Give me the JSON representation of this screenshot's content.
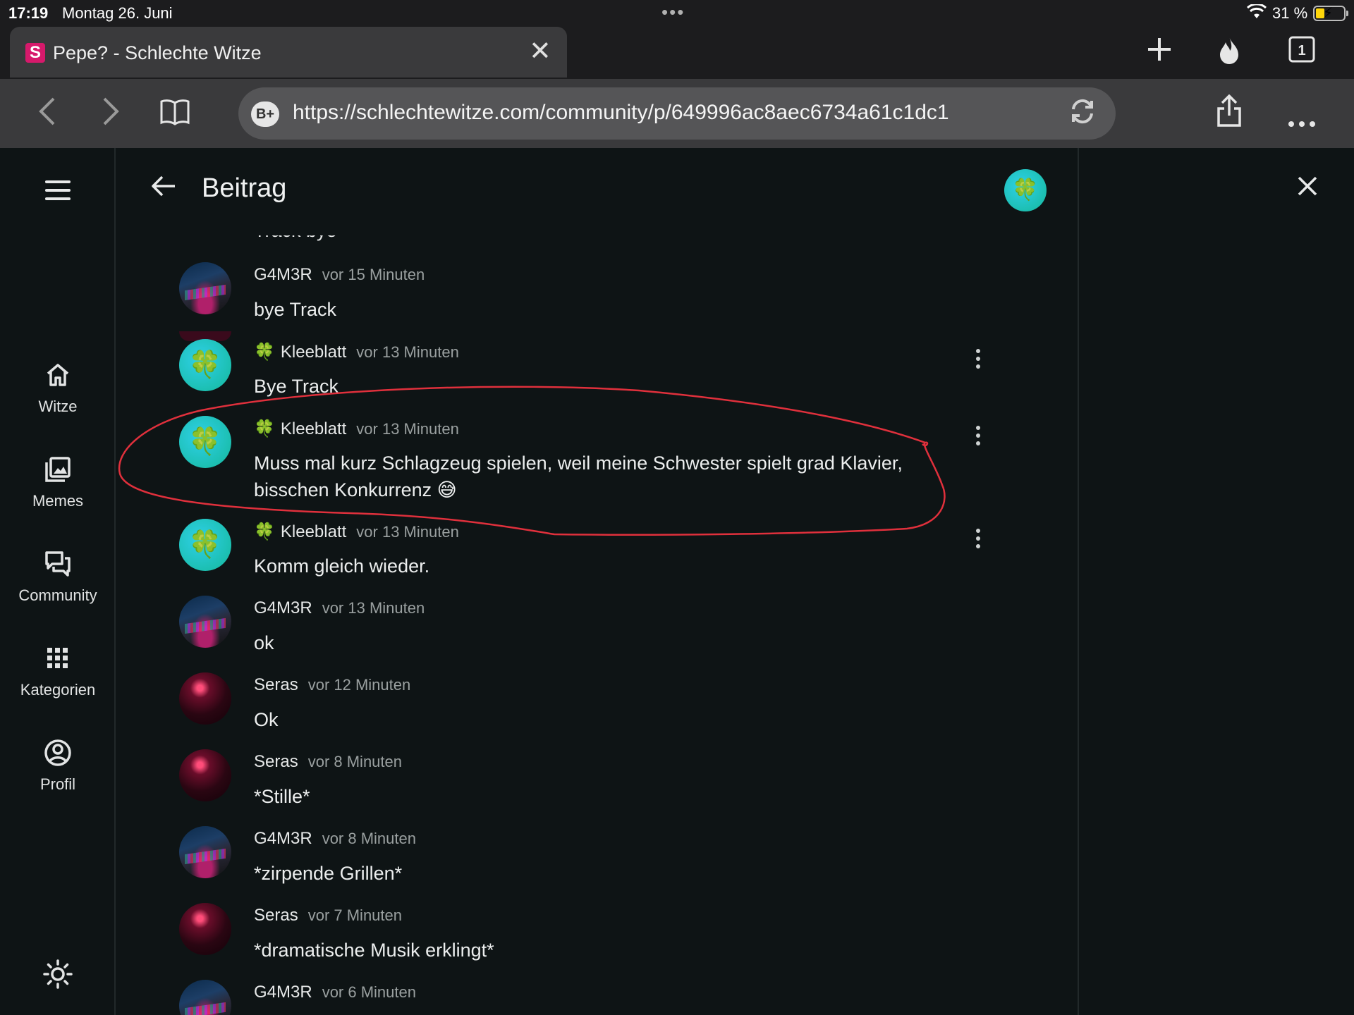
{
  "status_bar": {
    "time": "17:19",
    "date": "Montag 26. Juni",
    "battery": "31 %",
    "battery_level": 0.31
  },
  "browser": {
    "tab_title": "Pepe? - Schlechte Witze",
    "favicon_letter": "S",
    "tab_count": "1",
    "url": "https://schlechtewitze.com/community/p/649996ac8aec6734a61c1dc1",
    "url_badge": "B+"
  },
  "sidebar": {
    "items": [
      {
        "label": "Witze",
        "icon": "home-icon"
      },
      {
        "label": "Memes",
        "icon": "gallery-icon"
      },
      {
        "label": "Community",
        "icon": "forum-icon"
      },
      {
        "label": "Kategorien",
        "icon": "grid-icon"
      },
      {
        "label": "Profil",
        "icon": "profile-icon"
      }
    ]
  },
  "header": {
    "title": "Beitrag",
    "avatar_glyph": "🍀"
  },
  "messages": [
    {
      "author": "G4M3R",
      "time": "vor 15 Minuten",
      "text": "bye Track",
      "avatar": "keyboard",
      "menu": false
    },
    {
      "author": "Kleeblatt",
      "time": "vor 13 Minuten",
      "text": "Bye Track",
      "avatar": "clover",
      "menu": true
    },
    {
      "author": "Kleeblatt",
      "time": "vor 13 Minuten",
      "text": "Muss mal kurz Schlagzeug spielen, weil meine Schwester spielt grad Klavier, bisschen Konkurrenz 😅",
      "avatar": "clover",
      "menu": true
    },
    {
      "author": "Kleeblatt",
      "time": "vor 13 Minuten",
      "text": "Komm gleich wieder.",
      "avatar": "clover",
      "menu": true
    },
    {
      "author": "G4M3R",
      "time": "vor 13 Minuten",
      "text": "ok",
      "avatar": "keyboard",
      "menu": false
    },
    {
      "author": "Seras",
      "time": "vor 12 Minuten",
      "text": "Ok",
      "avatar": "seras",
      "menu": false
    },
    {
      "author": "Seras",
      "time": "vor 8 Minuten",
      "text": "*Stille*",
      "avatar": "seras",
      "menu": false
    },
    {
      "author": "G4M3R",
      "time": "vor 8 Minuten",
      "text": "*zirpende Grillen*",
      "avatar": "keyboard",
      "menu": false
    },
    {
      "author": "Seras",
      "time": "vor 7 Minuten",
      "text": "*dramatische Musik erklingt*",
      "avatar": "seras",
      "menu": false
    },
    {
      "author": "G4M3R",
      "time": "vor 6 Minuten",
      "text": "",
      "avatar": "keyboard",
      "menu": false
    }
  ],
  "partial_top_text": "Track bye",
  "colors": {
    "background": "#0e1415",
    "annotation_stroke": "#e0303c",
    "tab_favicon": "#d6196b"
  }
}
